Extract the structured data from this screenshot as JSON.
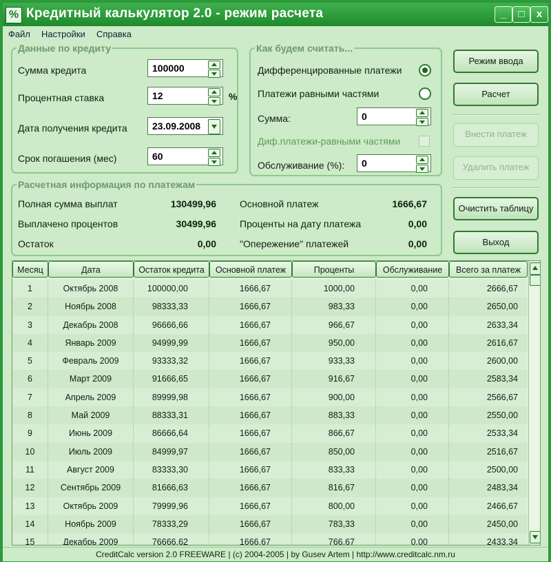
{
  "window": {
    "title": "Кредитный калькулятор 2.0 - режим расчета",
    "app_icon": "%",
    "controls": {
      "minimize": "_",
      "maximize": "□",
      "close": "x"
    }
  },
  "menu": [
    "Файл",
    "Настройки",
    "Справка"
  ],
  "credit": {
    "legend": "Данные по кредиту",
    "amount_label": "Сумма кредита",
    "amount_value": "100000",
    "rate_label": "Процентная ставка",
    "rate_value": "12",
    "rate_unit": "%",
    "date_label": "Дата получения кредита",
    "date_value": "23.09.2008",
    "term_label": "Срок погашения (мес)",
    "term_value": "60"
  },
  "calc": {
    "legend": "Как будем считать...",
    "diff_label": "Дифференцированные платежи",
    "equal_label": "Платежи равными частями",
    "sum_label": "Сумма:",
    "sum_value": "0",
    "mixed_label": "Диф.платежи-равными частями",
    "service_label": "Обслуживание (%):",
    "service_value": "0"
  },
  "summary": {
    "legend": "Расчетная информация по платежам",
    "total_label": "Полная сумма выплат",
    "total_value": "130499,96",
    "interest_label": "Выплачено процентов",
    "interest_value": "30499,96",
    "rest_label": "Остаток",
    "rest_value": "0,00",
    "principal_label": "Основной платеж",
    "principal_value": "1666,67",
    "date_interest_label": "Проценты на дату платежа",
    "date_interest_value": "0,00",
    "advance_label": "\"Опережение\" платежей",
    "advance_value": "0,00"
  },
  "buttons": {
    "input_mode": "Режим ввода",
    "calculate": "Расчет",
    "add_payment": "Внести платеж",
    "delete_payment": "Удалить платеж",
    "clear_table": "Очистить таблицу",
    "exit": "Выход"
  },
  "table": {
    "headers": [
      "Месяц",
      "Дата",
      "Остаток кредита",
      "Основной платеж",
      "Проценты",
      "Обслуживание",
      "Всего за платеж"
    ],
    "rows": [
      [
        "1",
        "Октябрь 2008",
        "100000,00",
        "1666,67",
        "1000,00",
        "0,00",
        "2666,67"
      ],
      [
        "2",
        "Ноябрь 2008",
        "98333,33",
        "1666,67",
        "983,33",
        "0,00",
        "2650,00"
      ],
      [
        "3",
        "Декабрь 2008",
        "96666,66",
        "1666,67",
        "966,67",
        "0,00",
        "2633,34"
      ],
      [
        "4",
        "Январь 2009",
        "94999,99",
        "1666,67",
        "950,00",
        "0,00",
        "2616,67"
      ],
      [
        "5",
        "Февраль 2009",
        "93333,32",
        "1666,67",
        "933,33",
        "0,00",
        "2600,00"
      ],
      [
        "6",
        "Март 2009",
        "91666,65",
        "1666,67",
        "916,67",
        "0,00",
        "2583,34"
      ],
      [
        "7",
        "Апрель 2009",
        "89999,98",
        "1666,67",
        "900,00",
        "0,00",
        "2566,67"
      ],
      [
        "8",
        "Май 2009",
        "88333,31",
        "1666,67",
        "883,33",
        "0,00",
        "2550,00"
      ],
      [
        "9",
        "Июнь 2009",
        "86666,64",
        "1666,67",
        "866,67",
        "0,00",
        "2533,34"
      ],
      [
        "10",
        "Июль 2009",
        "84999,97",
        "1666,67",
        "850,00",
        "0,00",
        "2516,67"
      ],
      [
        "11",
        "Август 2009",
        "83333,30",
        "1666,67",
        "833,33",
        "0,00",
        "2500,00"
      ],
      [
        "12",
        "Сентябрь 2009",
        "81666,63",
        "1666,67",
        "816,67",
        "0,00",
        "2483,34"
      ],
      [
        "13",
        "Октябрь 2009",
        "79999,96",
        "1666,67",
        "800,00",
        "0,00",
        "2466,67"
      ],
      [
        "14",
        "Ноябрь 2009",
        "78333,29",
        "1666,67",
        "783,33",
        "0,00",
        "2450,00"
      ],
      [
        "15",
        "Декабрь 2009",
        "76666,62",
        "1666,67",
        "766,67",
        "0,00",
        "2433,34"
      ]
    ]
  },
  "status": "CreditCalc version 2.0  FREEWARE   |   (c) 2004-2005   |   by Gusev Artem   |   http://www.creditcalc.nm.ru"
}
